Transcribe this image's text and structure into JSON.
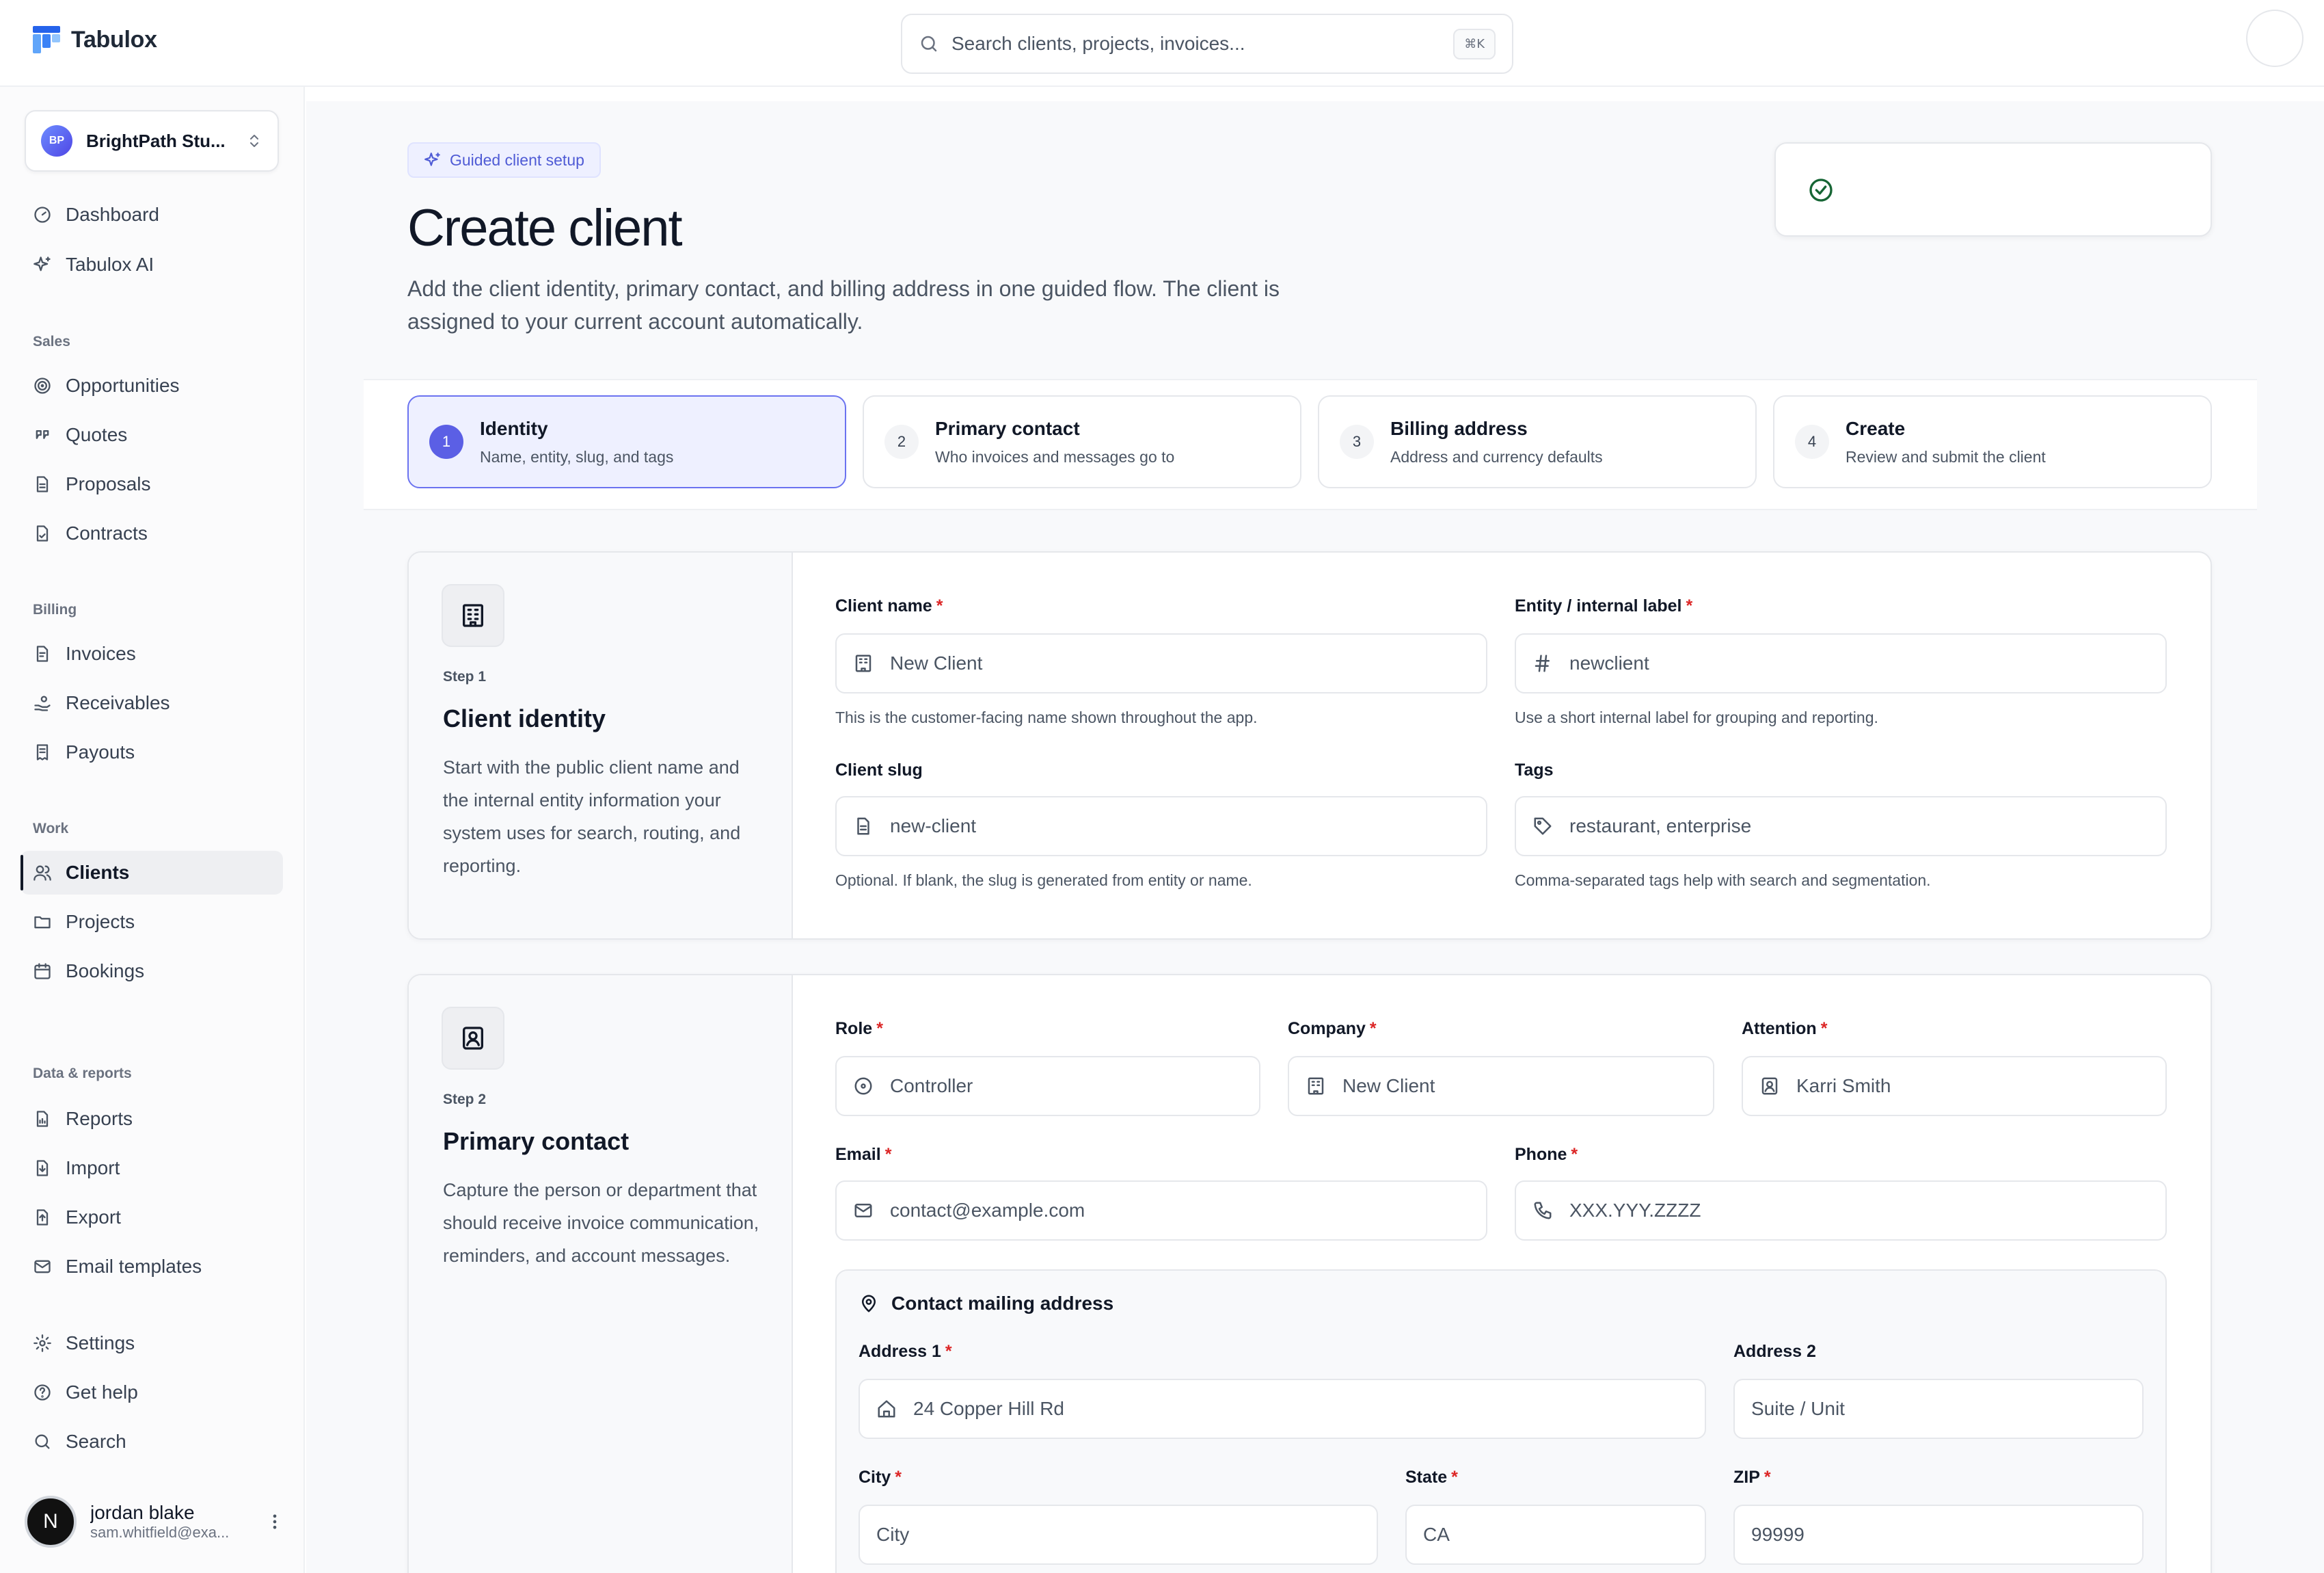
{
  "app": {
    "name": "Tabulox",
    "accent": "#5b5fe5"
  },
  "search": {
    "placeholder": "Search clients, projects, invoices...",
    "shortcut": "⌘K"
  },
  "org": {
    "initials": "BP",
    "name": "BrightPath Stu..."
  },
  "sidebar": {
    "top": [
      {
        "label": "Dashboard",
        "icon": "gauge-icon"
      },
      {
        "label": "Tabulox AI",
        "icon": "sparkles-icon"
      }
    ],
    "sections": [
      {
        "title": "Sales",
        "items": [
          {
            "label": "Opportunities",
            "icon": "target-icon"
          },
          {
            "label": "Quotes",
            "icon": "quote-icon"
          },
          {
            "label": "Proposals",
            "icon": "document-icon"
          },
          {
            "label": "Contracts",
            "icon": "contract-icon"
          }
        ]
      },
      {
        "title": "Billing",
        "items": [
          {
            "label": "Invoices",
            "icon": "invoice-icon"
          },
          {
            "label": "Receivables",
            "icon": "hand-coins-icon"
          },
          {
            "label": "Payouts",
            "icon": "receipt-icon"
          }
        ]
      },
      {
        "title": "Work",
        "items": [
          {
            "label": "Clients",
            "icon": "users-icon",
            "active": true
          },
          {
            "label": "Projects",
            "icon": "folder-icon"
          },
          {
            "label": "Bookings",
            "icon": "calendar-icon"
          }
        ]
      },
      {
        "title": "Data & reports",
        "items": [
          {
            "label": "Reports",
            "icon": "report-icon"
          },
          {
            "label": "Import",
            "icon": "import-icon"
          },
          {
            "label": "Export",
            "icon": "export-icon"
          },
          {
            "label": "Email templates",
            "icon": "mail-icon"
          }
        ]
      }
    ],
    "bottom": [
      {
        "label": "Settings",
        "icon": "gear-icon"
      },
      {
        "label": "Get help",
        "icon": "help-icon"
      },
      {
        "label": "Search",
        "icon": "search-icon"
      }
    ]
  },
  "user": {
    "initial": "N",
    "name": "jordan blake",
    "email": "sam.whitfield@exa..."
  },
  "page": {
    "badge": "Guided client setup",
    "title": "Create client",
    "description": "Add the client identity, primary contact, and billing address in one guided flow. The client is assigned to your current account automatically."
  },
  "steps": [
    {
      "num": "1",
      "title": "Identity",
      "sub": "Name, entity, slug, and tags",
      "active": true
    },
    {
      "num": "2",
      "title": "Primary contact",
      "sub": "Who invoices and messages go to"
    },
    {
      "num": "3",
      "title": "Billing address",
      "sub": "Address and currency defaults"
    },
    {
      "num": "4",
      "title": "Create",
      "sub": "Review and submit the client"
    }
  ],
  "identity": {
    "step": "Step 1",
    "title": "Client identity",
    "desc": "Start with the public client name and the internal entity information your system uses for search, routing, and reporting.",
    "client_name": {
      "label": "Client name",
      "placeholder": "New Client",
      "hint": "This is the customer-facing name shown throughout the app."
    },
    "entity": {
      "label": "Entity / internal label",
      "placeholder": "newclient",
      "hint": "Use a short internal label for grouping and reporting."
    },
    "slug": {
      "label": "Client slug",
      "placeholder": "new-client",
      "hint": "Optional. If blank, the slug is generated from entity or name."
    },
    "tags": {
      "label": "Tags",
      "placeholder": "restaurant, enterprise",
      "hint": "Comma-separated tags help with search and segmentation."
    }
  },
  "contact": {
    "step": "Step 2",
    "title": "Primary contact",
    "desc": "Capture the person or department that should receive invoice communication, reminders, and account messages.",
    "role": {
      "label": "Role",
      "placeholder": "Controller"
    },
    "company": {
      "label": "Company",
      "placeholder": "New Client"
    },
    "attention": {
      "label": "Attention",
      "placeholder": "Karri Smith"
    },
    "email": {
      "label": "Email",
      "placeholder": "contact@example.com"
    },
    "phone": {
      "label": "Phone",
      "placeholder": "XXX.YYY.ZZZZ"
    },
    "mailing_title": "Contact mailing address",
    "address1": {
      "label": "Address 1",
      "placeholder": "24 Copper Hill Rd"
    },
    "address2": {
      "label": "Address 2",
      "placeholder": "Suite / Unit"
    },
    "city": {
      "label": "City",
      "placeholder": "City"
    },
    "state": {
      "label": "State",
      "placeholder": "CA"
    },
    "zip": {
      "label": "ZIP",
      "placeholder": "99999"
    }
  },
  "required_mark": "*"
}
